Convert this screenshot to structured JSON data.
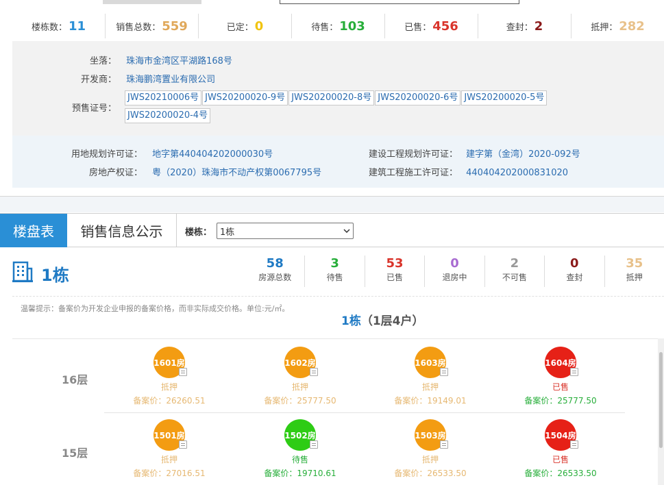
{
  "stats": [
    {
      "label": "楼栋数：",
      "value": "11",
      "color": "#2a8fd6"
    },
    {
      "label": "销售总数：",
      "value": "559",
      "color": "#e0a85a"
    },
    {
      "label": "已定：",
      "value": "0",
      "color": "#f1c40f"
    },
    {
      "label": "待售：",
      "value": "103",
      "color": "#27ae3a"
    },
    {
      "label": "已售：",
      "value": "456",
      "color": "#d9342b"
    },
    {
      "label": "查封：",
      "value": "2",
      "color": "#8b1a1a"
    },
    {
      "label": "抵押：",
      "value": "282",
      "color": "#e8c18a"
    }
  ],
  "info": {
    "location_label": "坐落：",
    "location": "珠海市金湾区平湖路168号",
    "developer_label": "开发商：",
    "developer": "珠海鹏湾置业有限公司",
    "presale_label": "预售证号：",
    "presale_licenses": [
      "JWS20210006号",
      "JWS20200020-9号",
      "JWS20200020-8号",
      "JWS20200020-6号",
      "JWS20200020-5号",
      "JWS20200020-4号"
    ],
    "land_permit_label": "用地规划许可证：",
    "land_permit": "地字第440404202000030号",
    "construction_plan_label": "建设工程规划许可证：",
    "construction_plan": "建字第（金湾）2020-092号",
    "property_label": "房地产权证：",
    "property": "粤（2020）珠海市不动产权第0067795号",
    "construction_permit_label": "建筑工程施工许可证：",
    "construction_permit": "440404202000831020"
  },
  "tabs": {
    "active": "楼盘表",
    "other": "销售信息公示"
  },
  "building_select": {
    "label": "楼栋：",
    "value": "1栋"
  },
  "building": {
    "name": "1栋",
    "counts": [
      {
        "value": "58",
        "label": "房源总数",
        "color": "#1f7ac4"
      },
      {
        "value": "3",
        "label": "待售",
        "color": "#27ae3a"
      },
      {
        "value": "53",
        "label": "已售",
        "color": "#d9342b"
      },
      {
        "value": "0",
        "label": "退房中",
        "color": "#a86bd1"
      },
      {
        "value": "2",
        "label": "不可售",
        "color": "#999999"
      },
      {
        "value": "0",
        "label": "查封",
        "color": "#8b1a1a"
      },
      {
        "value": "35",
        "label": "抵押",
        "color": "#e8c18a"
      }
    ]
  },
  "tip": "温馨提示：备案价为开发企业申报的备案价格，而非实际成交价格。单位:元/㎡。",
  "floor_title": {
    "main": "1栋",
    "sub": "（1层4户）"
  },
  "floors": [
    {
      "label": "16层",
      "units": [
        {
          "room": "1601房",
          "status": "抵押",
          "price": "备案价：26260.51",
          "color": "#f39c12",
          "text_color": "#e6b872"
        },
        {
          "room": "1602房",
          "status": "抵押",
          "price": "备案价：25777.50",
          "color": "#f39c12",
          "text_color": "#e6b872"
        },
        {
          "room": "1603房",
          "status": "抵押",
          "price": "备案价：19149.01",
          "color": "#f39c12",
          "text_color": "#e6b872"
        },
        {
          "room": "1604房",
          "status": "已售",
          "price": "备案价：25777.50",
          "color": "#e62117",
          "text_color": "#27ae3a"
        }
      ]
    },
    {
      "label": "15层",
      "units": [
        {
          "room": "1501房",
          "status": "抵押",
          "price": "备案价：27016.51",
          "color": "#f39c12",
          "text_color": "#e6b872"
        },
        {
          "room": "1502房",
          "status": "待售",
          "price": "备案价：19710.61",
          "color": "#2ecc15",
          "text_color": "#27ae3a"
        },
        {
          "room": "1503房",
          "status": "抵押",
          "price": "备案价：26533.50",
          "color": "#f39c12",
          "text_color": "#e6b872"
        },
        {
          "room": "1504房",
          "status": "已售",
          "price": "备案价：26533.50",
          "color": "#e62117",
          "text_color": "#27ae3a"
        }
      ]
    }
  ]
}
